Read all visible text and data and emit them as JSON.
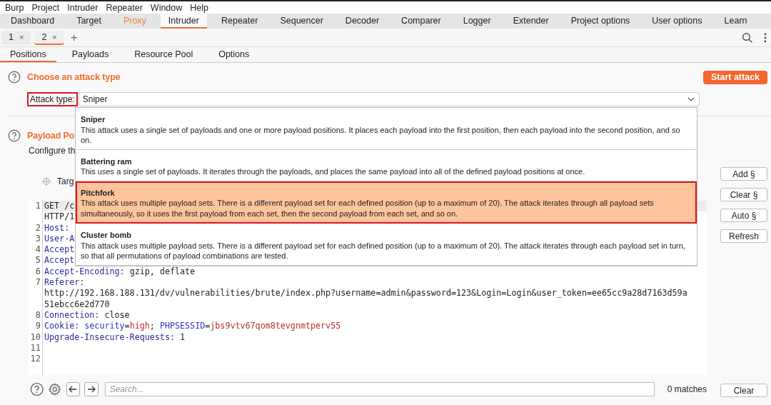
{
  "menu_bar": [
    "Burp",
    "Project",
    "Intruder",
    "Repeater",
    "Window",
    "Help"
  ],
  "main_tabs": [
    {
      "label": "Dashboard",
      "selected": false,
      "highlighted": false
    },
    {
      "label": "Target",
      "selected": false,
      "highlighted": false
    },
    {
      "label": "Proxy",
      "selected": false,
      "highlighted": true
    },
    {
      "label": "Intruder",
      "selected": true,
      "highlighted": false
    },
    {
      "label": "Repeater",
      "selected": false,
      "highlighted": false
    },
    {
      "label": "Sequencer",
      "selected": false,
      "highlighted": false
    },
    {
      "label": "Decoder",
      "selected": false,
      "highlighted": false
    },
    {
      "label": "Comparer",
      "selected": false,
      "highlighted": false
    },
    {
      "label": "Logger",
      "selected": false,
      "highlighted": false
    },
    {
      "label": "Extender",
      "selected": false,
      "highlighted": false
    },
    {
      "label": "Project options",
      "selected": false,
      "highlighted": false
    },
    {
      "label": "User options",
      "selected": false,
      "highlighted": false
    },
    {
      "label": "Learn",
      "selected": false,
      "highlighted": false
    }
  ],
  "attack_tabs": [
    {
      "label": "1",
      "close": "×",
      "selected": false
    },
    {
      "label": "2",
      "close": "×",
      "selected": true
    }
  ],
  "add_tab": "+",
  "sub_tabs": [
    {
      "label": "Positions",
      "selected": true
    },
    {
      "label": "Payloads",
      "selected": false
    },
    {
      "label": "Resource Pool",
      "selected": false
    },
    {
      "label": "Options",
      "selected": false
    }
  ],
  "attack_type_section": {
    "title": "Choose an attack type",
    "start_button": "Start attack",
    "label": "Attack type:",
    "label_outlined": true,
    "value": "Sniper"
  },
  "payload_section": {
    "title": "Payload Po",
    "description": "Configure th",
    "target_label": "Targ"
  },
  "editor": {
    "lines": [
      {
        "number": "1",
        "current": true,
        "segments": [
          {
            "kind": "text",
            "text": "GET /c"
          }
        ]
      },
      {
        "current": false,
        "segments": [
          {
            "kind": "text",
            "text": "HTTP/1"
          }
        ]
      },
      {
        "number": "2",
        "current": false,
        "segments": [
          {
            "kind": "header",
            "text": "Host:"
          }
        ]
      },
      {
        "number": "3",
        "current": false,
        "segments": [
          {
            "kind": "header",
            "text": "User-A"
          }
        ]
      },
      {
        "number": "4",
        "current": false,
        "segments": [
          {
            "kind": "header",
            "text": "Accept"
          }
        ]
      },
      {
        "number": "5",
        "current": false,
        "segments": [
          {
            "kind": "header",
            "text": "Accept"
          }
        ]
      },
      {
        "number": "6",
        "current": false,
        "segments": [
          {
            "kind": "header",
            "text": "Accept-Encoding:"
          },
          {
            "kind": "text",
            "text": " gzip, deflate"
          }
        ]
      },
      {
        "number": "7",
        "current": false,
        "segments": [
          {
            "kind": "header",
            "text": "Referer:"
          }
        ]
      },
      {
        "current": false,
        "segments": [
          {
            "kind": "text",
            "text": "http://192.168.188.131/dv/vulnerabilities/brute/index.php?username=admin&password=123&Login=Login&user_token=ee65cc9a28d7163d59a"
          }
        ]
      },
      {
        "current": false,
        "segments": [
          {
            "kind": "text",
            "text": "51ebcc6e2d770"
          }
        ]
      },
      {
        "number": "8",
        "current": false,
        "segments": [
          {
            "kind": "header",
            "text": "Connection:"
          },
          {
            "kind": "text",
            "text": " close"
          }
        ]
      },
      {
        "number": "9",
        "current": false,
        "segments": [
          {
            "kind": "header",
            "text": "Cookie: "
          },
          {
            "kind": "param_name",
            "text": "security"
          },
          {
            "kind": "text",
            "text": "="
          },
          {
            "kind": "param_value",
            "text": "high"
          },
          {
            "kind": "text",
            "text": "; "
          },
          {
            "kind": "param_name",
            "text": "PHPSESSID"
          },
          {
            "kind": "text",
            "text": "="
          },
          {
            "kind": "param_value",
            "text": "jbs9vtv67qom8tevgnmtperv55"
          }
        ]
      },
      {
        "number": "10",
        "current": false,
        "segments": [
          {
            "kind": "header",
            "text": "Upgrade-Insecure-Requests:"
          },
          {
            "kind": "text",
            "text": " 1"
          }
        ]
      },
      {
        "number": "11",
        "current": false
      },
      {
        "number": "12",
        "current": false
      }
    ]
  },
  "side_buttons": [
    "Add §",
    "Clear §",
    "Auto §",
    "Refresh"
  ],
  "search_bar": {
    "placeholder": "Search...",
    "matches": "0 matches",
    "clear_button": "Clear"
  },
  "dropdown": {
    "options": [
      {
        "name": "Sniper",
        "description": "This attack uses a single set of payloads and one or more payload positions. It places each payload into the first position, then each payload into the second position, and so on.",
        "selected": false
      },
      {
        "name": "Battering ram",
        "description": "This uses a single set of payloads. It iterates through the payloads, and places the same payload into all of the defined payload positions at once.",
        "selected": false
      },
      {
        "name": "Pitchfork",
        "description": "This attack uses multiple payload sets. There is a different payload set for each defined position (up to a maximum of 20). The attack iterates through all payload sets simultaneously, so it uses the first payload from each set, then the second payload from each set, and so on.",
        "selected": true
      },
      {
        "name": "Cluster bomb",
        "description": "This attack uses multiple payload sets. There is a different payload set for each defined position (up to a maximum of 20). The attack iterates through each payload set in turn, so that all permutations of payload combinations are tested.",
        "selected": false
      }
    ]
  }
}
